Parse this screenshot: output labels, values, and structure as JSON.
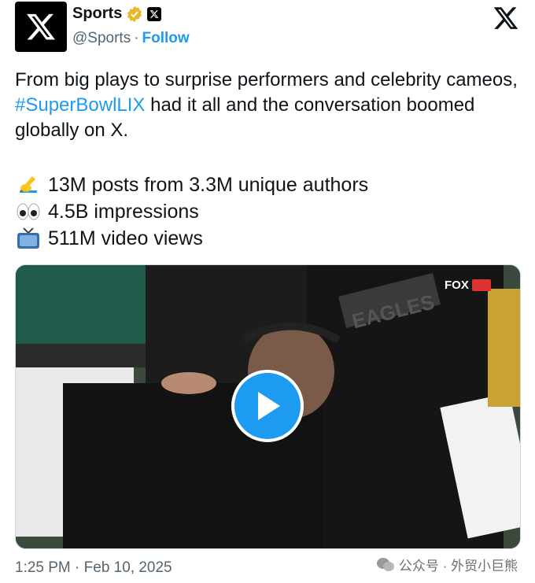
{
  "account": {
    "name": "Sports",
    "handle": "@Sports",
    "separator": "·",
    "follow_label": "Follow"
  },
  "post": {
    "text_before": "From big plays to surprise performers and celebrity cameos, ",
    "hashtag": "#SuperBowlLIX",
    "text_after": " had it all and the conversation boomed globally on X.",
    "stats": [
      {
        "icon": "writing-hand-icon",
        "text": "13M posts from 3.3M unique authors"
      },
      {
        "icon": "eyes-icon",
        "text": "4.5B impressions"
      },
      {
        "icon": "television-icon",
        "text": "511M video views"
      }
    ]
  },
  "media": {
    "overlay_text": "FOX",
    "jersey_text": "EAGLES"
  },
  "meta": {
    "timestamp": "1:25 PM · Feb 10, 2025"
  },
  "watermark": {
    "text": "公众号 · 外贸小巨熊"
  },
  "colors": {
    "accent": "#1d9bf0",
    "muted": "#536471",
    "verified_gold": "#e8b829"
  }
}
